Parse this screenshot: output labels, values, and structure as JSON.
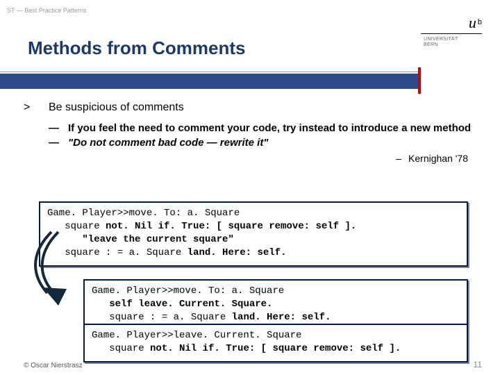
{
  "header": {
    "label": "ST — Best Practice Patterns"
  },
  "title": "Methods from Comments",
  "logo": {
    "u": "u",
    "b": "b",
    "line1": "UNIVERSITÄT",
    "line2": "BERN"
  },
  "bullet": {
    "mark": ">",
    "text": "Be suspicious of comments"
  },
  "subs": [
    {
      "mark": "—",
      "text": "If you feel the need to comment your code, try instead to introduce a new method"
    },
    {
      "mark": "—",
      "text": "\"Do not comment bad code — rewrite it\""
    }
  ],
  "attribution": {
    "dash": "–",
    "text": "Kernighan '78"
  },
  "code1": {
    "l1a": "Game. Player>>move. To: a. Square",
    "l2a": "   square ",
    "l2b": "not. Nil if. True: [ square remove: self ].",
    "l3a": "      \"leave the current square\"",
    "l4a": "   square : = a. Square ",
    "l4b": "land. Here: self."
  },
  "code2": {
    "l1a": "Game. Player>>move. To: a. Square",
    "l2a": "   ",
    "l2b": "self leave. Current. Square.",
    "l3a": "   square : = a. Square ",
    "l3b": "land. Here: self."
  },
  "code3": {
    "l1a": "Game. Player>>leave. Current. Square",
    "l2a": "   square ",
    "l2b": "not. Nil if. True: [ square remove: self ]."
  },
  "footer": {
    "copyright": "© Oscar Nierstrasz",
    "page": "11"
  }
}
